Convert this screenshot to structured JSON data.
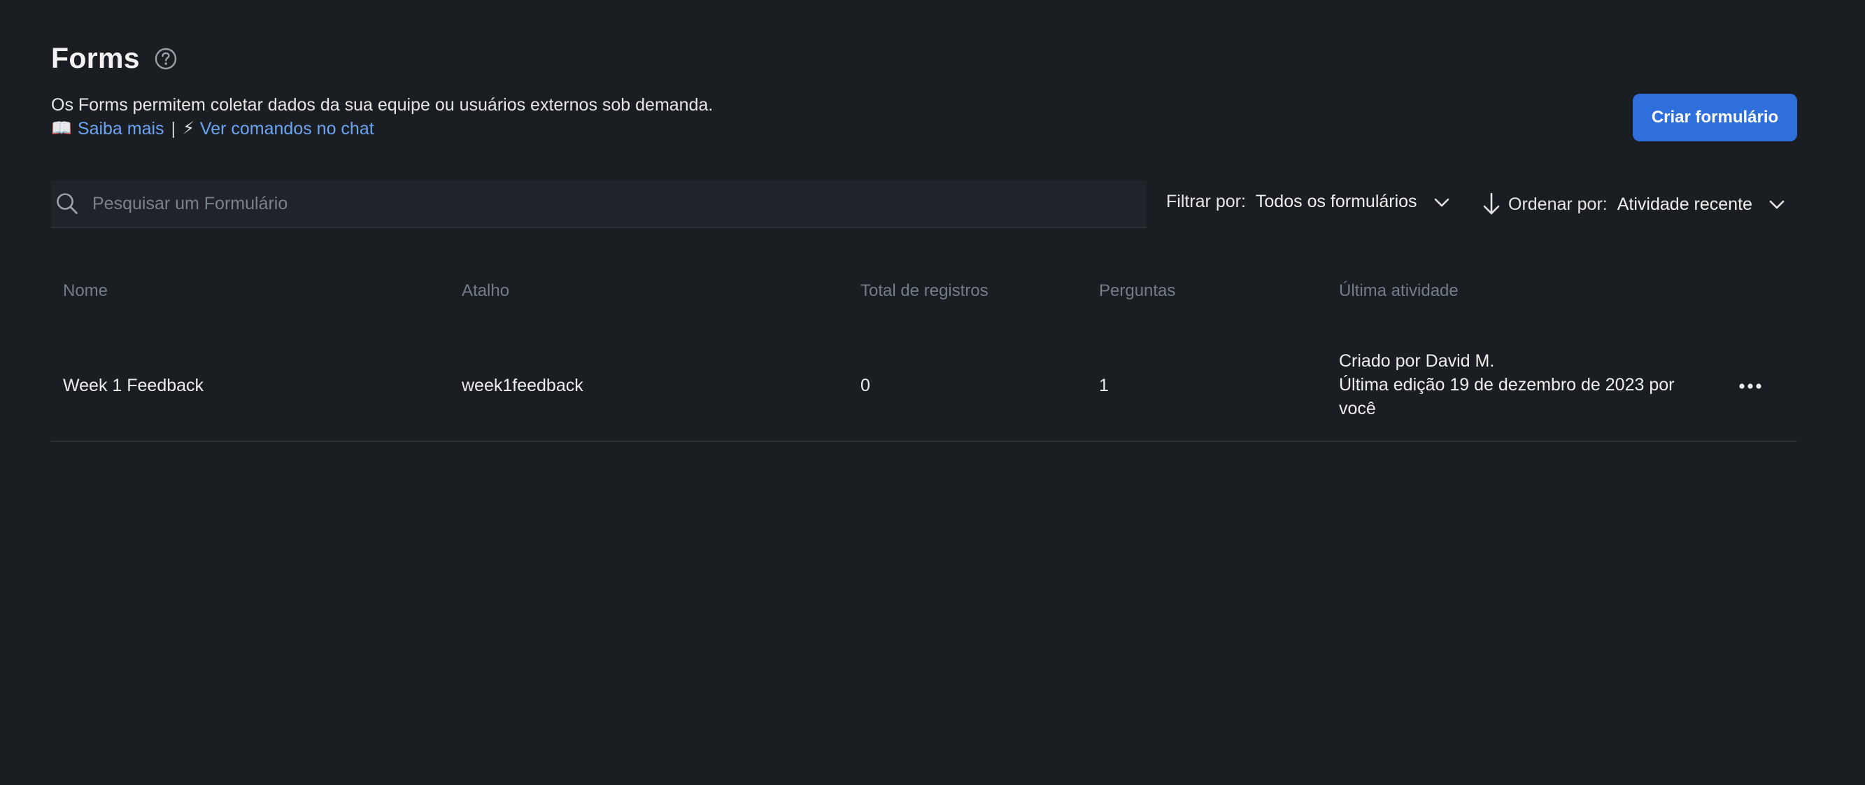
{
  "header": {
    "title": "Forms",
    "description": "Os Forms permitem coletar dados da sua equipe ou usuários externos sob demanda.",
    "learn_more_emoji": "📖",
    "learn_more_label": "Saiba mais",
    "separator": "|",
    "commands_emoji": "⚡",
    "commands_label": "Ver comandos no chat",
    "create_button_label": "Criar formulário"
  },
  "search": {
    "placeholder": "Pesquisar um Formulário",
    "value": ""
  },
  "filter": {
    "label": "Filtrar por:",
    "value": "Todos os formulários"
  },
  "sort": {
    "label": "Ordenar por:",
    "value": "Atividade recente"
  },
  "table": {
    "columns": [
      "Nome",
      "Atalho",
      "Total de registros",
      "Perguntas",
      "Última atividade"
    ],
    "rows": [
      {
        "name": "Week 1 Feedback",
        "shortcut": "week1feedback",
        "total_records": "0",
        "questions": "1",
        "activity_line1": "Criado por David M.",
        "activity_line2": "Última edição 19 de dezembro de 2023 por você"
      }
    ]
  },
  "colors": {
    "background": "#1a1d21",
    "accent": "#2f6fdb",
    "link": "#6ba4f2",
    "muted": "#737d8a"
  },
  "icons": {
    "help": "question-circle-icon",
    "search": "search-icon",
    "chevron": "chevron-down-icon",
    "sort_arrow": "arrow-down-icon",
    "more": "ellipsis-icon"
  }
}
